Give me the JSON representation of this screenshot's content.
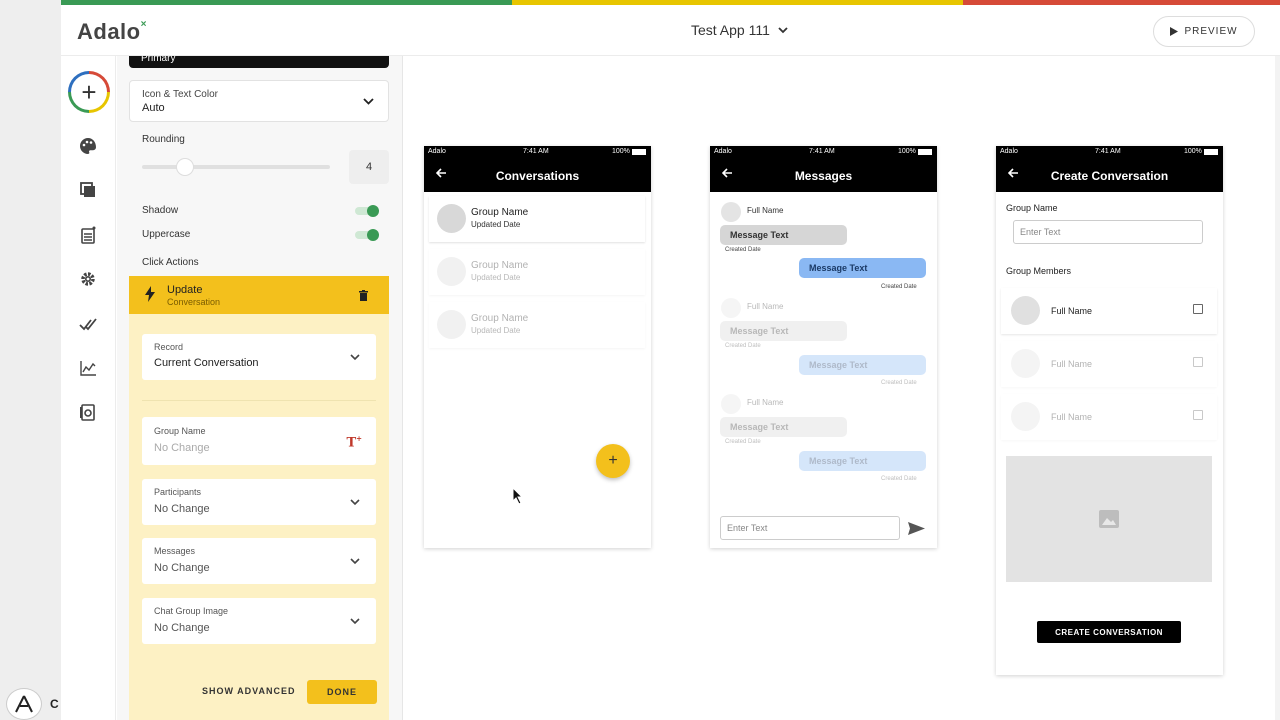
{
  "header": {
    "logo": "Adalo",
    "app_name": "Test App 111",
    "preview_label": "PREVIEW"
  },
  "taskbar": {
    "label": "C"
  },
  "panel": {
    "primary_label": "Primary",
    "icon_text_color": {
      "label": "Icon & Text Color",
      "value": "Auto"
    },
    "rounding": {
      "label": "Rounding",
      "value": "4",
      "level": 0.23
    },
    "shadow_label": "Shadow",
    "shadow_on": true,
    "uppercase_label": "Uppercase",
    "uppercase_on": true,
    "click_actions_label": "Click Actions",
    "action": {
      "title": "Update",
      "subtitle": "Conversation",
      "record": {
        "label": "Record",
        "value": "Current Conversation"
      },
      "fields": [
        {
          "label": "Group Name",
          "value": "No Change"
        },
        {
          "label": "Participants",
          "value": "No Change"
        },
        {
          "label": "Messages",
          "value": "No Change"
        },
        {
          "label": "Chat Group Image",
          "value": "No Change"
        }
      ],
      "show_advanced": "SHOW ADVANCED",
      "done": "DONE"
    }
  },
  "screens": {
    "status": {
      "carrier": "Adalo",
      "time": "7:41 AM",
      "battery": "100%"
    },
    "conversations": {
      "title": "Conversations",
      "rows": [
        {
          "name": "Group Name",
          "date": "Updated Date"
        },
        {
          "name": "Group Name",
          "date": "Updated Date"
        },
        {
          "name": "Group Name",
          "date": "Updated Date"
        }
      ],
      "fab": "+"
    },
    "messages": {
      "title": "Messages",
      "groups": [
        {
          "name": "Full Name",
          "left_text": "Message Text",
          "left_date": "Created Date",
          "right_text": "Message Text",
          "right_date": "Created Date"
        },
        {
          "name": "Full Name",
          "left_text": "Message Text",
          "left_date": "Created Date",
          "right_text": "Message Text",
          "right_date": "Created Date"
        },
        {
          "name": "Full Name",
          "left_text": "Message Text",
          "left_date": "Created Date",
          "right_text": "Message Text",
          "right_date": "Created Date"
        }
      ],
      "input_placeholder": "Enter Text"
    },
    "create": {
      "title": "Create Conversation",
      "group_name_label": "Group Name",
      "input_placeholder": "Enter Text",
      "members_label": "Group Members",
      "members": [
        {
          "name": "Full Name"
        },
        {
          "name": "Full Name"
        },
        {
          "name": "Full Name"
        }
      ],
      "button": "CREATE CONVERSATION"
    }
  }
}
